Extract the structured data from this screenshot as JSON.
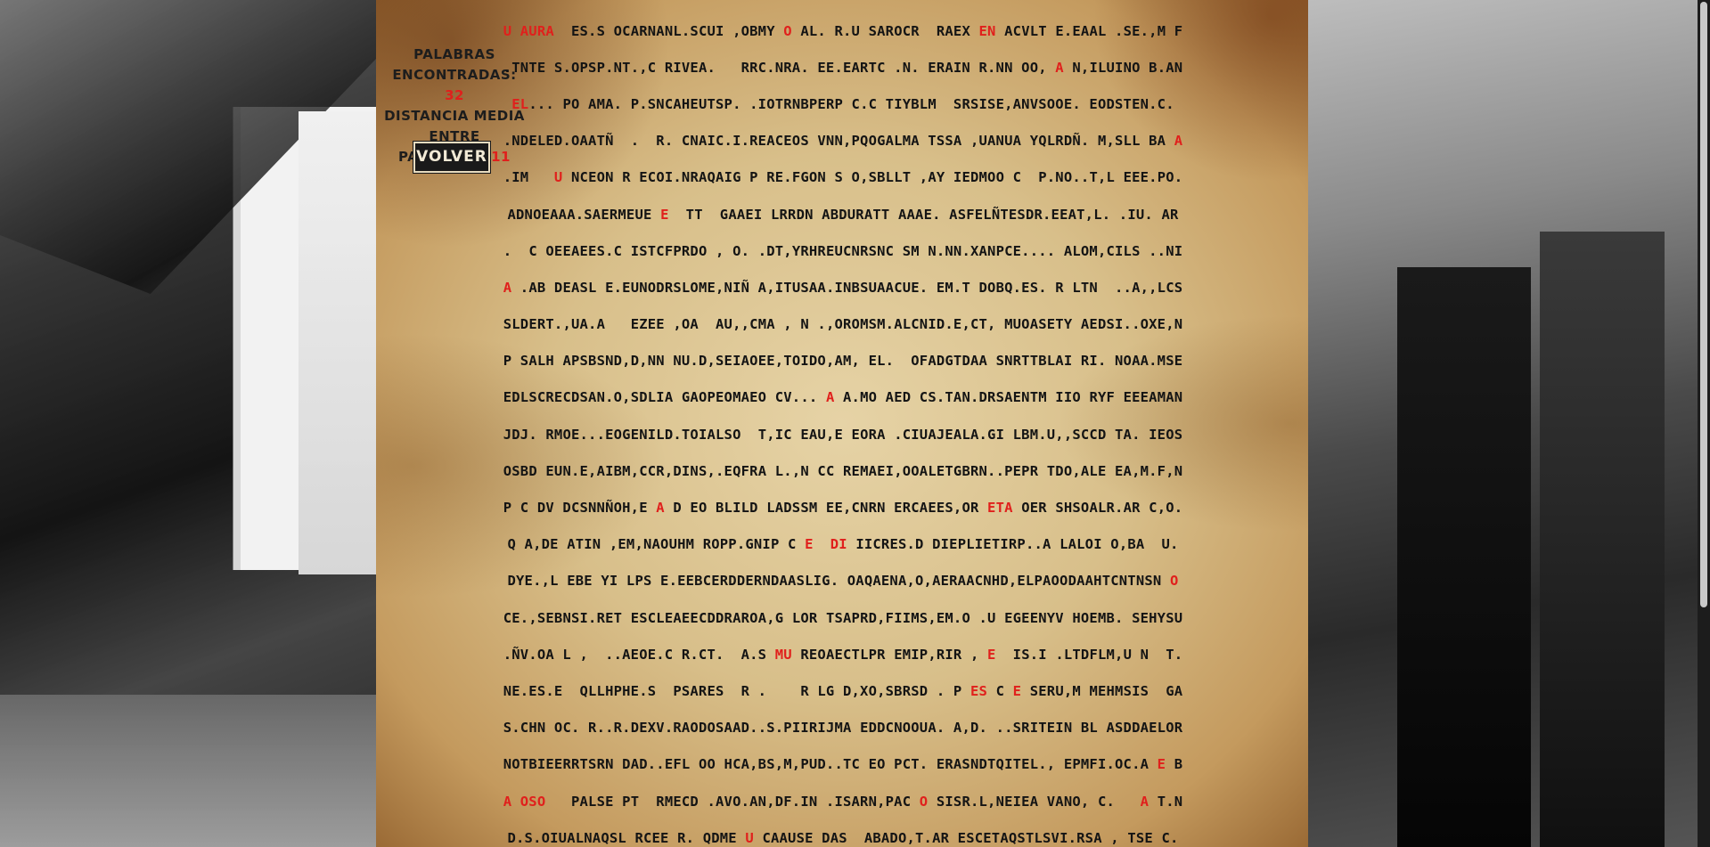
{
  "stats": {
    "line1": "PALABRAS",
    "line2_label": "ENCONTRADAS:",
    "found_count": "32",
    "line3": "DISTANCIA MEDIA",
    "line4_label": "ENTRE PALABRAS:",
    "avg_distance": "11"
  },
  "back_button": {
    "label": "VOLVER"
  },
  "grid_rows": [
    [
      [
        "U AURA",
        1
      ],
      [
        "  ES.S OCARNANL.SCUI ,OBMY ",
        0
      ],
      [
        "O",
        1
      ],
      [
        " AL. R.U SAROCR  RAEX ",
        0
      ],
      [
        "EN",
        1
      ],
      [
        " ACVLT E.EAAL .SE.,M F",
        0
      ]
    ],
    [
      [
        ".TNTE S.OPSP.NT.,C RIVEA.   RRC.NRA. EE.EARTC .N. ERAIN R.NN OO, ",
        0
      ],
      [
        "A",
        1
      ],
      [
        " N,ILUINO B.AN",
        0
      ]
    ],
    [
      [
        "EL",
        1
      ],
      [
        "... PO AMA. P.SNCAHEUTSP. .IOTRNBPERP C.C TIYBLM  SRSISE,ANVSOOE. EODSTEN.C.",
        0
      ]
    ],
    [
      [
        ".NDELED.OAATÑ  .  R. CNAIC.I.REACEOS VNN,PQOGALMA TSSA ,UANUA YQLRDÑ. M,SLL BA ",
        0
      ],
      [
        "A",
        1
      ]
    ],
    [
      [
        ".IM   ",
        0
      ],
      [
        "U",
        1
      ],
      [
        " NCEON R ECOI.NRAQAIG P RE.FGON S O,SBLLT ,AY IEDMOO C  P.NO..T,L EEE.PO.",
        0
      ]
    ],
    [
      [
        "ADNOEAAA.SAERMEUE ",
        0
      ],
      [
        "E",
        1
      ],
      [
        "  TT  GAAEI LRRDN ABDURATT AAAE. ASFELÑTESDR.EEAT,L. .IU. AR",
        0
      ]
    ],
    [
      [
        ".  C OEEAEES.C ISTCFPRDO , O. .DT,YRHREUCNRSNC SM N.NN.XANPCE.... ALOM,CILS ..NI",
        0
      ]
    ],
    [
      [
        "A",
        1
      ],
      [
        " .AB DEASL E.EUNODRSLOME,NIÑ A,ITUSAA.INBSUAACUE. EM.T DOBQ.ES. R LTN  ..A,,LCS",
        0
      ]
    ],
    [
      [
        "SLDERT.,UA.A   EZEE ,OA  AU,,CMA , N .,OROMSM.ALCNID.E,CT, MUOASETY AEDSI..OXE,N",
        0
      ]
    ],
    [
      [
        "P SALH APSBSND,D,NN NU.D,SEIAOEE,TOIDO,AM, EL.  OFADGTDAA SNRTTBLAI RI. NOAA.MSE",
        0
      ]
    ],
    [
      [
        "EDLSCRECDSAN.O,SDLIA GAOPEOMAEO CV... ",
        0
      ],
      [
        "A",
        1
      ],
      [
        " A.MO AED CS.TAN.DRSAENTM IIO RYF EEEAMAN",
        0
      ]
    ],
    [
      [
        "JDJ. RMOE...EOGENILD.TOIALSO  T,IC EAU,E EORA .CIUAJEALA.GI LBM.U,,SCCD TA. IEOS",
        0
      ]
    ],
    [
      [
        "OSBD EUN.E,AIBM,CCR,DINS,.EQFRA L.,N CC REMAEI,OOALETGBRN..PEPR TDO,ALE EA,M.F,N",
        0
      ]
    ],
    [
      [
        "P C DV DCSNNÑOH,E ",
        0
      ],
      [
        "A",
        1
      ],
      [
        " D EO BLILD LADSSM EE,CNRN ERCAEES,OR ",
        0
      ],
      [
        "ETA",
        1
      ],
      [
        " OER SHSOALR.AR C,O.",
        0
      ]
    ],
    [
      [
        "Q A,DE ATIN ,EM,NAOUHM ROPP.GNIP C ",
        0
      ],
      [
        "E",
        1
      ],
      [
        "  ",
        0
      ],
      [
        "DI",
        1
      ],
      [
        " IICRES.D DIEPLIETIRP..A LALOI O,BA  U.",
        0
      ]
    ],
    [
      [
        "DYE.,L EBE YI LPS E.EEBCERDDERNDAASLIG. OAQAENA,O,AERAACNHD,ELPAOODAAHTCNTNSN ",
        0
      ],
      [
        "O",
        1
      ]
    ],
    [
      [
        "CE.,SEBNSI.RET ESCLEAEECDDRAROA,G LOR TSAPRD,FIIMS,EM.O .U EGEENYV HOEMB. SEHYSU",
        0
      ]
    ],
    [
      [
        ".ÑV.OA L ,  ..AEOE.C R.CT.  A.S ",
        0
      ],
      [
        "MU",
        1
      ],
      [
        " REOAECTLPR EMIP,RIR , ",
        0
      ],
      [
        "E",
        1
      ],
      [
        "  IS.I .LTDFLM,U N  T.",
        0
      ]
    ],
    [
      [
        "NE.ES.E  QLLHPHE.S  PSARES  R .    R LG D,XO,SBRSD . P ",
        0
      ],
      [
        "ES",
        1
      ],
      [
        " C ",
        0
      ],
      [
        "E",
        1
      ],
      [
        " SERU,M MEHMSIS  GA",
        0
      ]
    ],
    [
      [
        "S.CHN OC. R..R.DEXV.RAODOSAAD..S.PIIRIJMA EDDCNOOUA. A,D. ..SRITEIN BL ASDDAELOR",
        0
      ]
    ],
    [
      [
        "NOTBIEERRTSRN DAD..EFL OO HCA,BS,M,PUD..TC EO PCT. ERASNDTQITEL., EPMFI.OC.A ",
        0
      ],
      [
        "E",
        1
      ],
      [
        " B",
        0
      ]
    ],
    [
      [
        "A OSO",
        1
      ],
      [
        "   PALSE PT  RMECD .AVO.AN,DF.IN .ISARN,PAC ",
        0
      ],
      [
        "O",
        1
      ],
      [
        " SISR.L,NEIEA VANO, C.   ",
        0
      ],
      [
        "A",
        1
      ],
      [
        " T.N",
        0
      ]
    ],
    [
      [
        "D.S.OIUALNAQSL RCEE R. QDME ",
        0
      ],
      [
        "U",
        1
      ],
      [
        " CAAUSE DAS  ABADO,T.AR ESCETAQSTLSVI.RSA , TSE C.",
        0
      ]
    ]
  ],
  "colors": {
    "highlight": "#e0201c",
    "text": "#141414",
    "button_bg": "#1a1a1a"
  }
}
